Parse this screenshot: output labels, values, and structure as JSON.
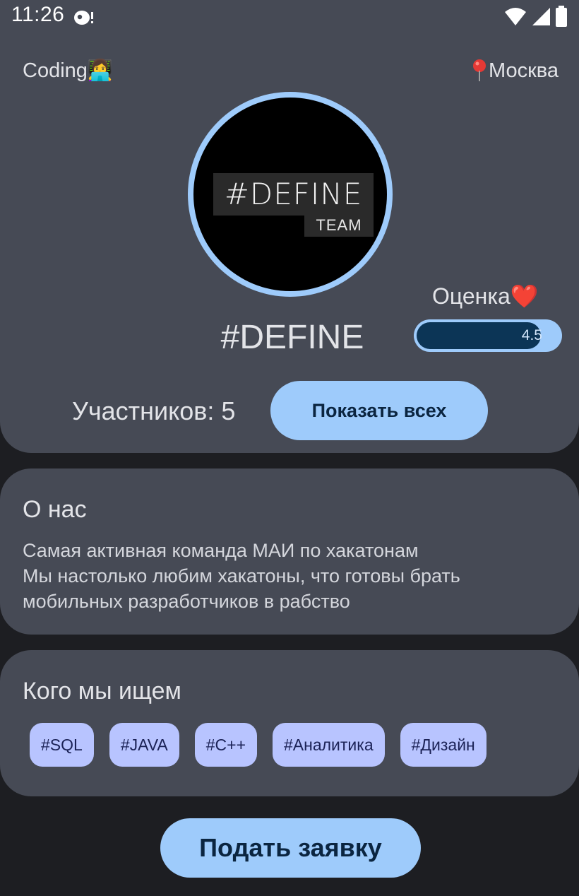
{
  "status_bar": {
    "time": "11:26"
  },
  "header": {
    "category": "Coding👩‍💻",
    "location": "Москва",
    "team_name": "#DEFINE",
    "logo": {
      "main": "#DEFINE",
      "sub": "TEAM"
    },
    "rating_label": "Оценка❤️",
    "rating_value": "4.5",
    "rating_max": 5,
    "members_text": "Участников: 5",
    "show_all_label": "Показать всех"
  },
  "about": {
    "title": "О нас",
    "text": "Самая активная команда МАИ по хакатонам\nМы настолько любим хакатоны, что готовы брать мобильных разработчиков в рабство"
  },
  "seeking": {
    "title": "Кого мы ищем",
    "tags": [
      "#SQL",
      "#JAVA",
      "#C++",
      "#Аналитика",
      "#Дизайн"
    ]
  },
  "apply_label": "Подать заявку",
  "colors": {
    "card": "#464a55",
    "background": "#1d1e22",
    "accent": "#9ecbfb",
    "tag": "#b8c4ff",
    "rating_fill": "#0c3556"
  },
  "icons": {
    "location": "map-pin-icon",
    "notification": "status-notification-icon",
    "wifi": "wifi-icon",
    "signal": "cell-signal-icon",
    "battery": "battery-icon"
  }
}
